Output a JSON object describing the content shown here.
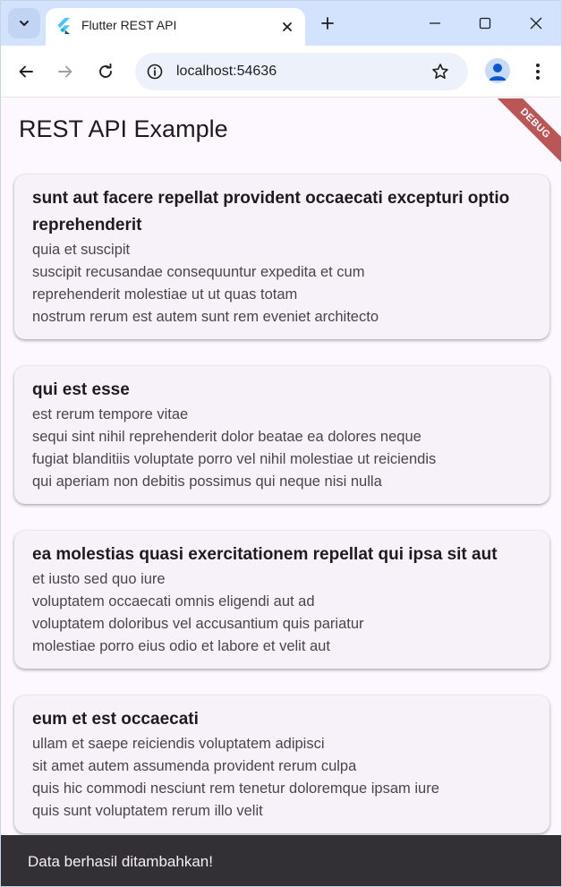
{
  "browser": {
    "tab_title": "Flutter REST API",
    "url": "localhost:54636"
  },
  "icons": {
    "tab_search": "chevron-down-icon",
    "favicon": "flutter-logo-icon",
    "tab_close": "close-icon",
    "new_tab": "plus-icon",
    "minimize": "minimize-icon",
    "maximize": "maximize-icon",
    "close_window": "close-icon",
    "back": "arrow-left-icon",
    "forward": "arrow-right-icon",
    "reload": "reload-icon",
    "site_info": "info-icon",
    "bookmark": "star-icon",
    "profile": "person-icon",
    "menu": "more-vert-icon"
  },
  "app": {
    "title": "REST API Example",
    "debug_banner": "DEBUG",
    "posts": [
      {
        "title": "sunt aut facere repellat provident occaecati excepturi optio reprehenderit",
        "body": "quia et suscipit\nsuscipit recusandae consequuntur expedita et cum\nreprehenderit molestiae ut ut quas totam\nnostrum rerum est autem sunt rem eveniet architecto"
      },
      {
        "title": "qui est esse",
        "body": "est rerum tempore vitae\nsequi sint nihil reprehenderit dolor beatae ea dolores neque\nfugiat blanditiis voluptate porro vel nihil molestiae ut reiciendis\nqui aperiam non debitis possimus qui neque nisi nulla"
      },
      {
        "title": "ea molestias quasi exercitationem repellat qui ipsa sit aut",
        "body": "et iusto sed quo iure\nvoluptatem occaecati omnis eligendi aut ad\nvoluptatem doloribus vel accusantium quis pariatur\nmolestiae porro eius odio et labore et velit aut"
      },
      {
        "title": "eum et est occaecati",
        "body": "ullam et saepe reiciendis voluptatem adipisci\nsit amet autem assumenda provident rerum culpa\nquis hic commodi nesciunt rem tenetur doloremque ipsam iure\nquis sunt voluptatem rerum illo velit"
      }
    ],
    "snackbar": "Data berhasil ditambahkan!"
  },
  "colors": {
    "tabstrip": "#d3e3fd",
    "app_background": "#fdf7ff",
    "card_background": "#f7f2fa",
    "snackbar_background": "#322f35",
    "debug_banner": "#b03a3a"
  }
}
